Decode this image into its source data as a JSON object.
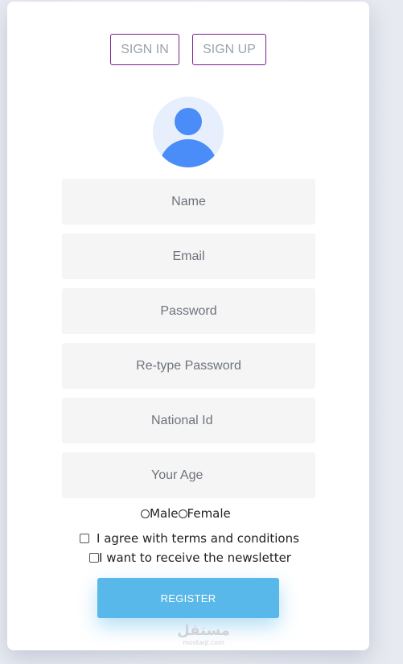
{
  "tabs": {
    "sign_in": "SIGN IN",
    "sign_up": "SIGN UP"
  },
  "avatar": {
    "icon": "user-avatar-icon"
  },
  "form": {
    "name_placeholder": "Name",
    "email_placeholder": "Email",
    "password_placeholder": "Password",
    "retype_password_placeholder": "Re-type Password",
    "national_id_placeholder": "National Id",
    "age_placeholder": "Your Age",
    "gender": {
      "male_label": "Male",
      "female_label": "Female"
    },
    "terms_label": "I agree with terms and conditions",
    "newsletter_label": "I want to receive the newsletter",
    "register_label": "REGISTER"
  },
  "watermark": {
    "arabic": "مستقل",
    "latin": "mostaql.com"
  },
  "colors": {
    "tab_border": "#7a1f8f",
    "button": "#59b8ea",
    "avatar_fill": "#4a8df8",
    "avatar_bg": "#e8effc",
    "field_bg": "#f5f5f6"
  }
}
